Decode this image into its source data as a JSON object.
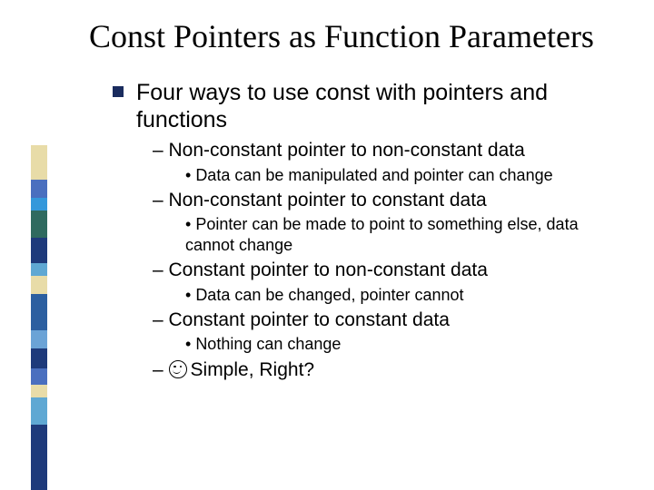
{
  "title": "Const Pointers as Function Parameters",
  "lvl1": "Four ways to use const with pointers and functions",
  "items": [
    {
      "h": "Non-constant pointer to non-constant data",
      "d": "Data can be manipulated and pointer can change"
    },
    {
      "h": "Non-constant pointer to constant data",
      "d": "Pointer can be made to point to something else, data cannot change"
    },
    {
      "h": "Constant pointer to non-constant data",
      "d": "Data can be changed, pointer cannot"
    },
    {
      "h": "Constant pointer to constant data",
      "d": "Nothing can change"
    }
  ],
  "closing": "Simple, Right?"
}
